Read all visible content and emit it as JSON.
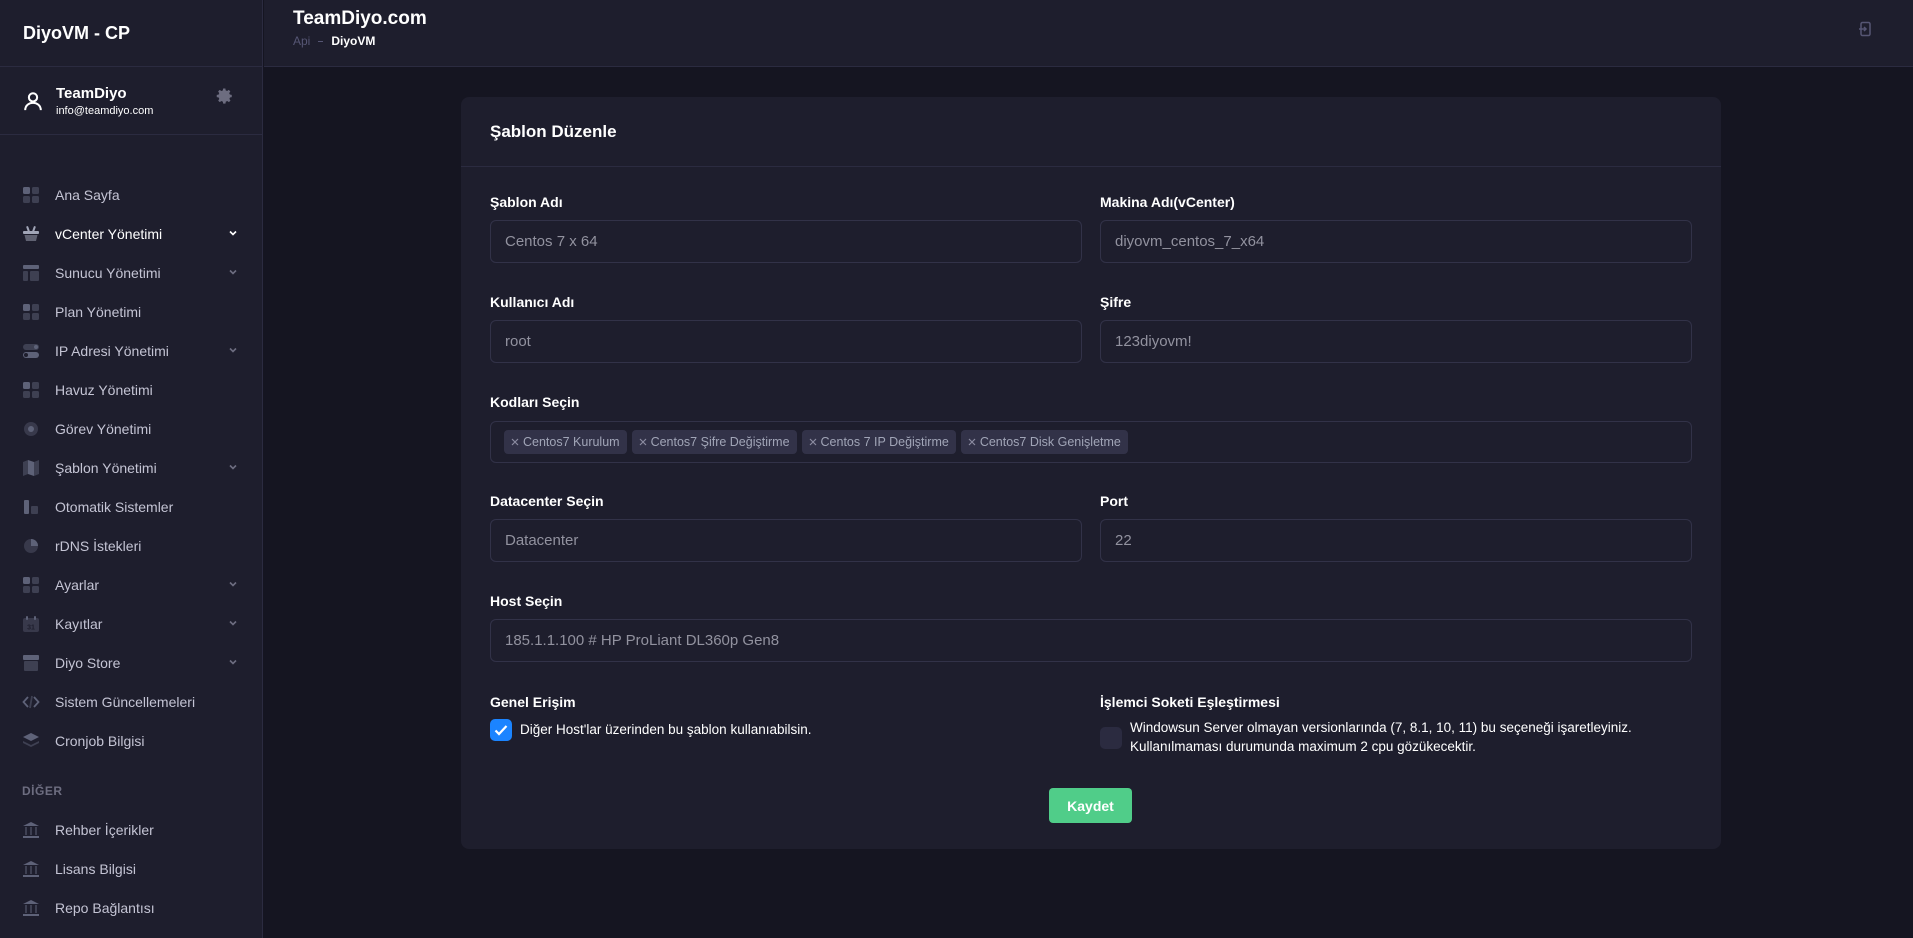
{
  "app": {
    "brand": "DiyoVM - CP"
  },
  "user": {
    "name": "TeamDiyo",
    "email": "info@teamdiyo.com"
  },
  "header": {
    "title": "TeamDiyo.com",
    "breadcrumb": [
      "Api",
      "DiyoVM"
    ]
  },
  "sidebar": {
    "items": [
      {
        "label": "Ana Sayfa",
        "icon": "dashboard-icon"
      },
      {
        "label": "vCenter Yönetimi",
        "icon": "basket-icon"
      },
      {
        "label": "Sunucu Yönetimi",
        "icon": "layout-icon"
      },
      {
        "label": "Plan Yönetimi",
        "icon": "grid-icon"
      },
      {
        "label": "IP Adresi Yönetimi",
        "icon": "toggle-icon"
      },
      {
        "label": "Havuz Yönetimi",
        "icon": "grid-icon"
      },
      {
        "label": "Görev Yönetimi",
        "icon": "target-icon"
      },
      {
        "label": "Şablon Yönetimi",
        "icon": "map-icon"
      },
      {
        "label": "Otomatik Sistemler",
        "icon": "chart-icon"
      },
      {
        "label": "rDNS İstekleri",
        "icon": "pie-icon"
      },
      {
        "label": "Ayarlar",
        "icon": "grid-icon"
      },
      {
        "label": "Kayıtlar",
        "icon": "calendar-icon"
      },
      {
        "label": "Diyo Store",
        "icon": "store-icon"
      },
      {
        "label": "Sistem Güncellemeleri",
        "icon": "code-icon"
      },
      {
        "label": "Cronjob Bilgisi",
        "icon": "layers-icon"
      }
    ],
    "section_label": "DİĞER",
    "other_items": [
      {
        "label": "Rehber İçerikler",
        "icon": "bank-icon"
      },
      {
        "label": "Lisans Bilgisi",
        "icon": "bank-icon"
      },
      {
        "label": "Repo Bağlantısı",
        "icon": "bank-icon"
      }
    ]
  },
  "form": {
    "title": "Şablon Düzenle",
    "template_name": {
      "label": "Şablon Adı",
      "value": "Centos 7 x 64"
    },
    "machine_name": {
      "label": "Makina Adı(vCenter)",
      "value": "diyovm_centos_7_x64"
    },
    "username": {
      "label": "Kullanıcı Adı",
      "value": "root"
    },
    "password": {
      "label": "Şifre",
      "value": "123diyovm!"
    },
    "codes": {
      "label": "Kodları Seçin",
      "tags": [
        "Centos7 Kurulum",
        "Centos7 Şifre Değiştirme",
        "Centos 7 IP Değiştirme",
        "Centos7 Disk Genişletme"
      ]
    },
    "datacenter": {
      "label": "Datacenter Seçin",
      "placeholder": "Datacenter"
    },
    "port": {
      "label": "Port",
      "value": "22"
    },
    "host": {
      "label": "Host Seçin",
      "value": "185.1.1.100 # HP ProLiant DL360p Gen8"
    },
    "public_access": {
      "label": "Genel Erişim",
      "checkbox_text": "Diğer Host'lar üzerinden bu şablon kullanıabilsin.",
      "checked": true
    },
    "cpu_socket": {
      "label": "İşlemci Soketi Eşleştirmesi",
      "checkbox_text_line1": "Windowsun Server olmayan versionlarında (7, 8.1, 10, 11) bu seçeneği işaretleyiniz.",
      "checkbox_text_line2": "Kullanılmaması durumunda maximum 2 cpu gözükecektir.",
      "checked": false
    },
    "save_label": "Kaydet"
  }
}
